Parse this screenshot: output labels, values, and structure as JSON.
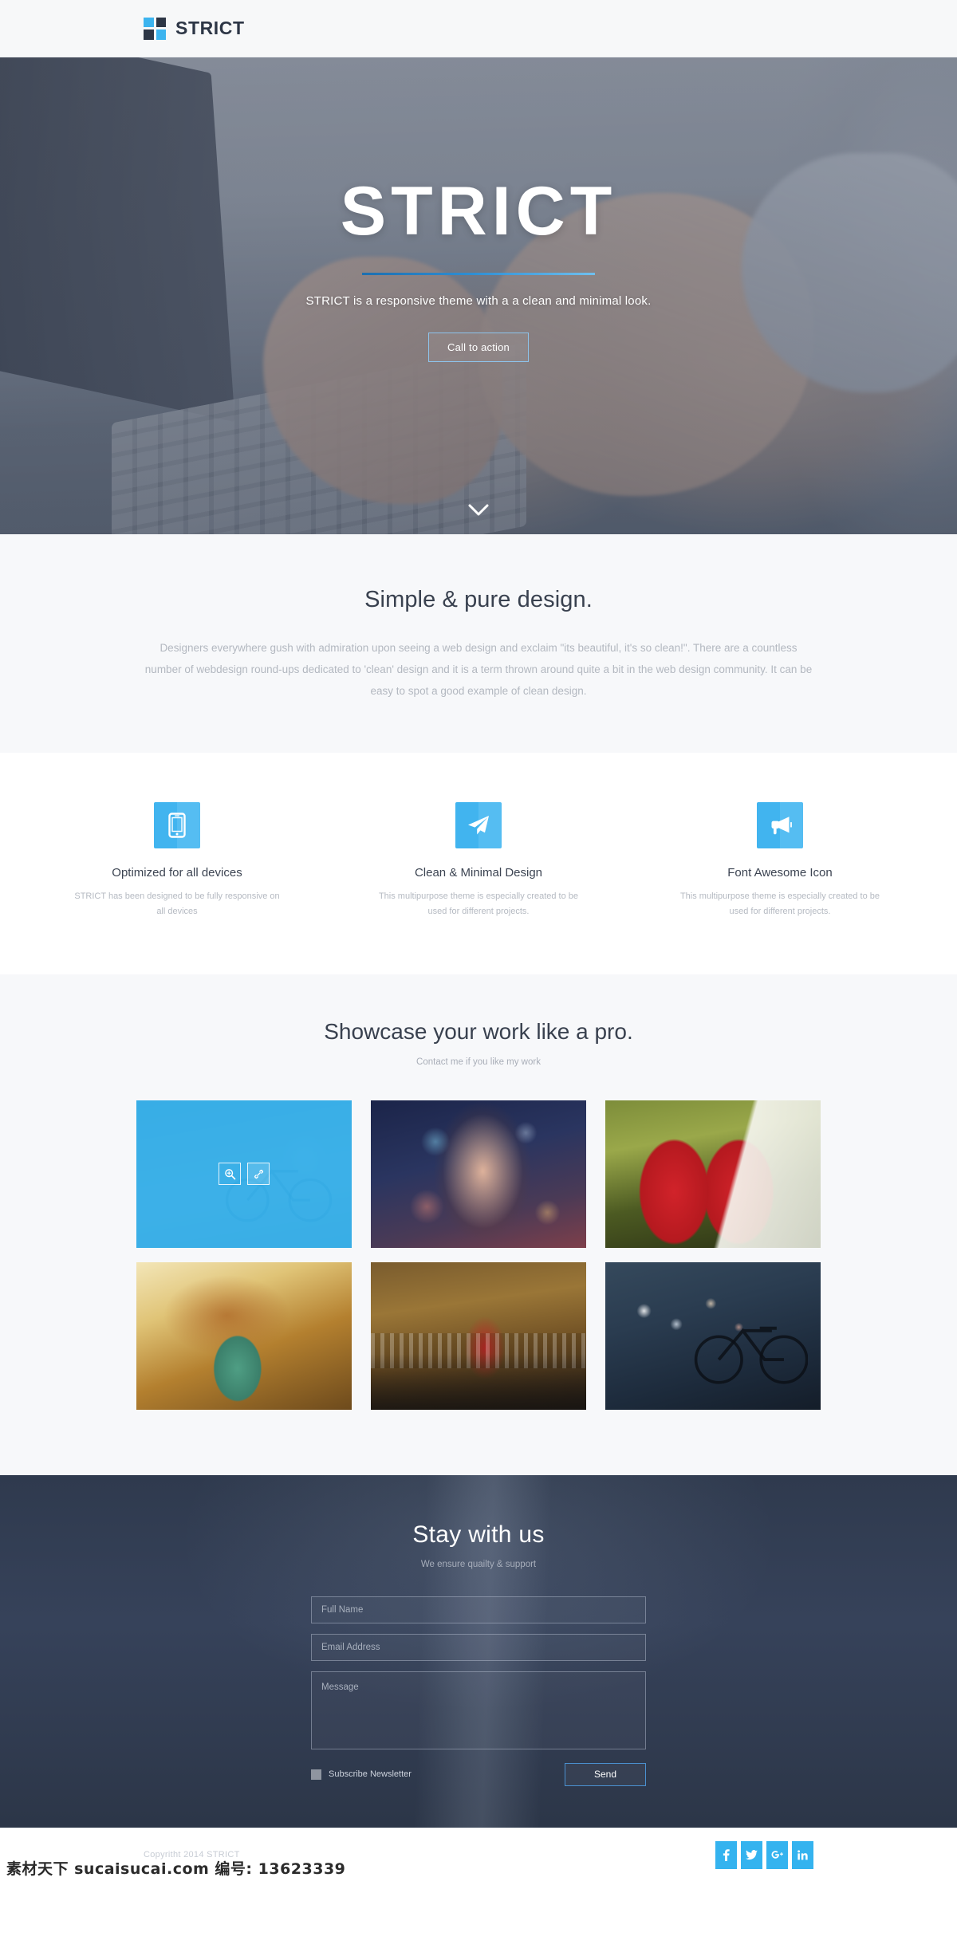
{
  "navbar": {
    "brand": "STRICT",
    "logo_icon": "logo-squares-icon",
    "colors": {
      "blue": "#3cb4ef",
      "dark": "#2d3646"
    }
  },
  "hero": {
    "title": "STRICT",
    "subtitle": "STRICT is a responsive theme with a a clean and minimal look.",
    "cta_label": "Call to action",
    "scroll_icon": "chevron-down-icon",
    "divider_gradient": [
      "#1c6fb0",
      "#6fc0ef"
    ]
  },
  "intro": {
    "title": "Simple & pure design.",
    "body": "Designers everywhere gush with admiration upon seeing a web design and exclaim \"its beautiful, it's so clean!\". There are a countless number of webdesign round-ups dedicated to 'clean' design and it is a term thrown around quite a bit in the web design community. It can be easy to spot a good example of clean design."
  },
  "features": {
    "accent_color": "#41b4ef",
    "items": [
      {
        "icon": "mobile-phone-icon",
        "title": "Optimized for all devices",
        "text": "STRICT has been designed to be fully responsive on all devices"
      },
      {
        "icon": "paper-plane-icon",
        "title": "Clean & Minimal Design",
        "text": "This multipurpose theme is especially created to be used for different projects."
      },
      {
        "icon": "bullhorn-icon",
        "title": "Font Awesome Icon",
        "text": "This multipurpose theme is especially created to be used for different projects."
      }
    ]
  },
  "showcase": {
    "title": "Showcase your work like a pro.",
    "subtitle": "Contact me if you like my work",
    "overlay_color": "#29acEB",
    "items": [
      {
        "name": "bicycle-on-street",
        "hovered": true,
        "zoom_icon": "search-plus-icon",
        "link_icon": "link-icon"
      },
      {
        "name": "woman-with-sunglasses",
        "hovered": false
      },
      {
        "name": "red-smiley-mugs",
        "hovered": false
      },
      {
        "name": "coffee-splash-green-mug",
        "hovered": false
      },
      {
        "name": "red-bicycle-by-wall",
        "hovered": false
      },
      {
        "name": "bicycle-at-night",
        "hovered": false
      }
    ]
  },
  "contact": {
    "title": "Stay with us",
    "subtitle": "We ensure quailty & support",
    "fields": {
      "name_placeholder": "Full Name",
      "name_value": "",
      "email_placeholder": "Email Address",
      "email_value": "",
      "message_placeholder": "Message",
      "message_value": ""
    },
    "subscribe_label": "Subscribe Newsletter",
    "subscribe_checked": false,
    "send_label": "Send",
    "send_border_color": "#4a90cf"
  },
  "footer": {
    "copyright": "Copyritht 2014 STRICT",
    "watermark": "素材天下 sucaisucai.com 编号: 13623339",
    "social_color": "#34b3ef",
    "socials": [
      {
        "icon": "facebook-icon",
        "label": "f"
      },
      {
        "icon": "twitter-icon",
        "label": "t"
      },
      {
        "icon": "google-plus-icon",
        "label": "g+"
      },
      {
        "icon": "linkedin-icon",
        "label": "in"
      }
    ]
  }
}
